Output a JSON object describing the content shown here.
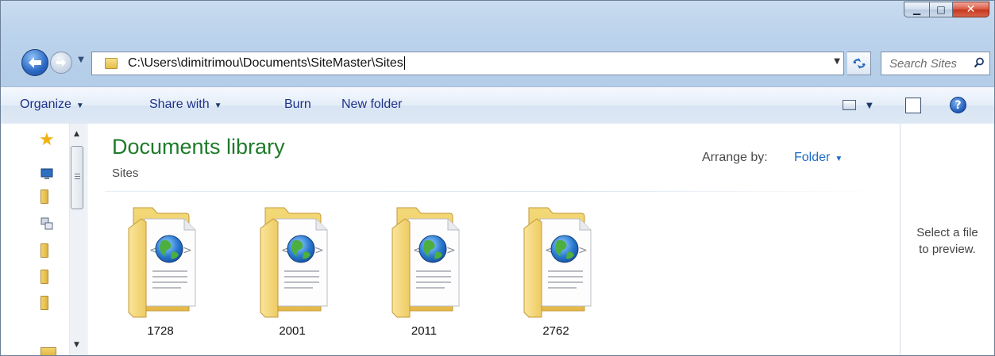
{
  "window": {
    "minimize_symbol": "▁",
    "maximize_symbol": "□",
    "close_symbol": "✕"
  },
  "navigation": {
    "back_icon": "arrow-left",
    "forward_icon": "arrow-right"
  },
  "address_bar": {
    "path": "C:\\Users\\dimitrimou\\Documents\\SiteMaster\\Sites"
  },
  "search": {
    "placeholder": "Search Sites"
  },
  "toolbar": {
    "organize": "Organize",
    "share_with": "Share with",
    "burn": "Burn",
    "new_folder": "New folder"
  },
  "library": {
    "title": "Documents library",
    "subtitle": "Sites",
    "arrange_label": "Arrange by:",
    "arrange_value": "Folder"
  },
  "folders": [
    {
      "name": "1728"
    },
    {
      "name": "2001"
    },
    {
      "name": "2011"
    },
    {
      "name": "2762"
    }
  ],
  "preview": {
    "message": "Select a file\nto preview."
  },
  "colors": {
    "library_title": "#1e7a2a",
    "link_blue": "#1e6bc4",
    "toolbar_text": "#1e3287"
  }
}
